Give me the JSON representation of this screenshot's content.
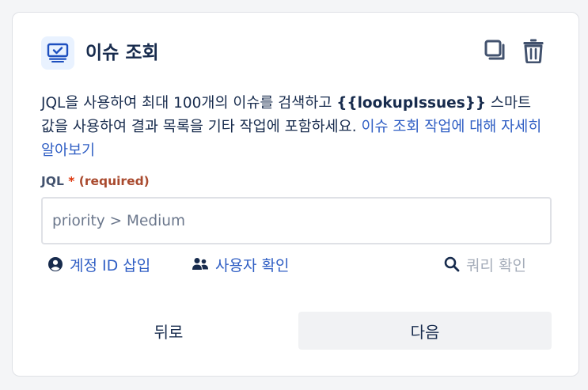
{
  "header": {
    "title": "이슈 조회",
    "icon": "monitor-check-icon",
    "actions": [
      "duplicate-icon",
      "trash-icon"
    ]
  },
  "description": {
    "text_before": "JQL을 사용하여 최대 100개의 이슈를 검색하고 ",
    "smart_value": "{{lookupIssues}}",
    "text_after": " 스마트 값을 사용하여 결과 목록을 기타 작업에 포함하세요. ",
    "link": "이슈 조회 작업에 대해 자세히 알아보기"
  },
  "jql": {
    "label": "JQL",
    "required_mark": "*",
    "required_text": "(required)",
    "value": "",
    "placeholder": "priority > Medium"
  },
  "helpers": {
    "account_id": "계정 ID 삽입",
    "user_lookup": "사용자 확인",
    "query_check": "쿼리 확인"
  },
  "footer": {
    "back": "뒤로",
    "next": "다음"
  },
  "colors": {
    "accent": "#2f5ec4",
    "text": "#172b4d",
    "required": "#de350b",
    "muted": "#a5adba"
  }
}
